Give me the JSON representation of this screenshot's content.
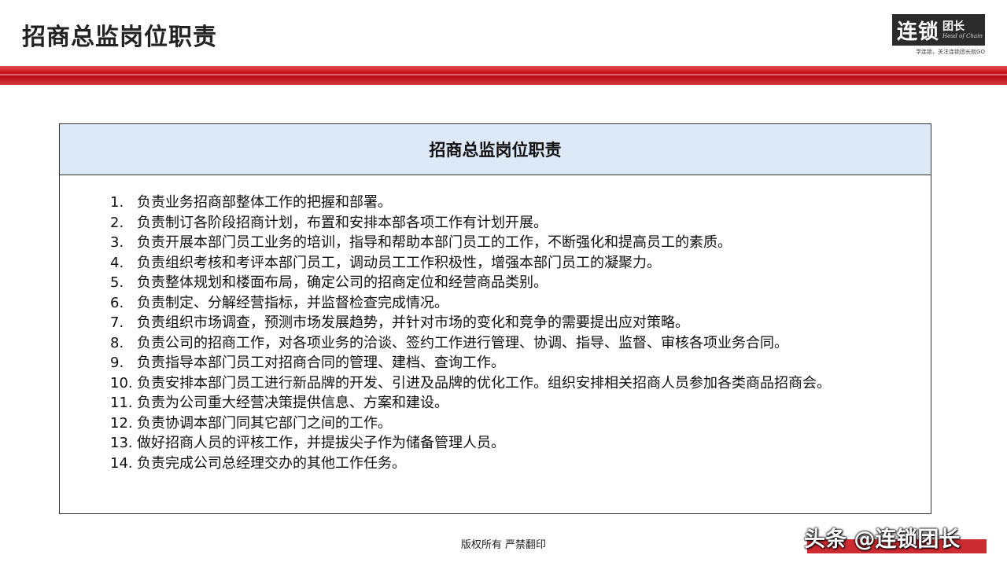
{
  "header": {
    "title": "招商总监岗位职责",
    "logo": {
      "main": "连锁",
      "side": "团长",
      "english": "Head of Chain",
      "slogan": "学连锁，关注连锁团长就GO"
    }
  },
  "card": {
    "title": "招商总监岗位职责",
    "items": [
      {
        "num": "1.",
        "text": "负责业务招商部整体工作的把握和部署。"
      },
      {
        "num": "2.",
        "text": "负责制订各阶段招商计划，布置和安排本部各项工作有计划开展。"
      },
      {
        "num": "3.",
        "text": "负责开展本部门员工业务的培训，指导和帮助本部门员工的工作，不断强化和提高员工的素质。"
      },
      {
        "num": "4.",
        "text": "负责组织考核和考评本部门员工，调动员工工作积极性，增强本部门员工的凝聚力。"
      },
      {
        "num": "5.",
        "text": "负责整体规划和楼面布局，确定公司的招商定位和经营商品类别。"
      },
      {
        "num": "6.",
        "text": "负责制定、分解经营指标，并监督检查完成情况。"
      },
      {
        "num": "7.",
        "text": "负责组织市场调查，预测市场发展趋势，并针对市场的变化和竞争的需要提出应对策略。"
      },
      {
        "num": "8.",
        "text": "负责公司的招商工作，对各项业务的洽谈、签约工作进行管理、协调、指导、监督、审核各项业务合同。"
      },
      {
        "num": "9.",
        "text": "负责指导本部门员工对招商合同的管理、建档、查询工作。"
      },
      {
        "num": "10.",
        "text": "负责安排本部门员工进行新品牌的开发、引进及品牌的优化工作。组织安排相关招商人员参加各类商品招商会。"
      },
      {
        "num": "11.",
        "text": "负责为公司重大经营决策提供信息、方案和建设。"
      },
      {
        "num": "12.",
        "text": "负责协调本部门同其它部门之间的工作。"
      },
      {
        "num": "13.",
        "text": "做好招商人员的评核工作，并提拔尖子作为储备管理人员。"
      },
      {
        "num": "14.",
        "text": "负责完成公司总经理交办的其他工作任务。"
      }
    ]
  },
  "footer": {
    "copyright": "版权所有  严禁翻印",
    "watermark": "头条 @连锁团长"
  },
  "colors": {
    "accent_red": "#c8141c",
    "header_fill": "#dde9f6"
  }
}
